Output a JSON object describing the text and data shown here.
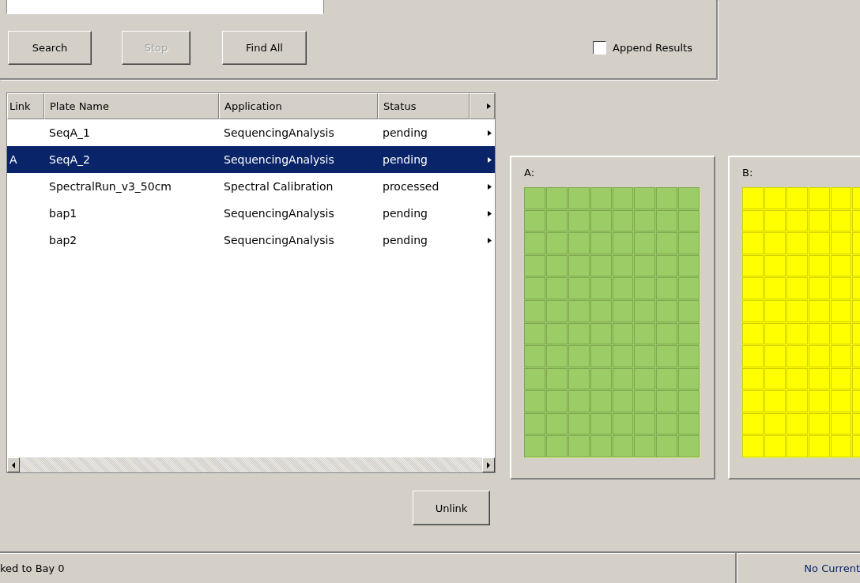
{
  "search_panel": {
    "buttons": [
      {
        "label": "Search",
        "disabled": false
      },
      {
        "label": "Stop",
        "disabled": true
      },
      {
        "label": "Find All",
        "disabled": false
      }
    ],
    "append_results": {
      "label": "Append Results",
      "checked": false
    }
  },
  "table": {
    "columns": [
      "Link",
      "Plate Name",
      "Application",
      "Status"
    ],
    "rows": [
      {
        "link": "",
        "plate_name": "SeqA_1",
        "application": "SequencingAnalysis",
        "status": "pending",
        "selected": false
      },
      {
        "link": "A",
        "plate_name": "SeqA_2",
        "application": "SequencingAnalysis",
        "status": "pending",
        "selected": true
      },
      {
        "link": "",
        "plate_name": "SpectralRun_v3_50cm",
        "application": "Spectral Calibration",
        "status": "processed",
        "selected": false
      },
      {
        "link": "",
        "plate_name": "bap1",
        "application": "SequencingAnalysis",
        "status": "pending",
        "selected": false
      },
      {
        "link": "",
        "plate_name": "bap2",
        "application": "SequencingAnalysis",
        "status": "pending",
        "selected": false
      }
    ]
  },
  "unlink_button": "Unlink",
  "plates": [
    {
      "label": "A:",
      "color": "#9ccc65"
    },
    {
      "label": "B:",
      "color": "#ffff00"
    }
  ],
  "status_bar": {
    "message": "ked to Bay 0",
    "run_status": "No Current"
  }
}
